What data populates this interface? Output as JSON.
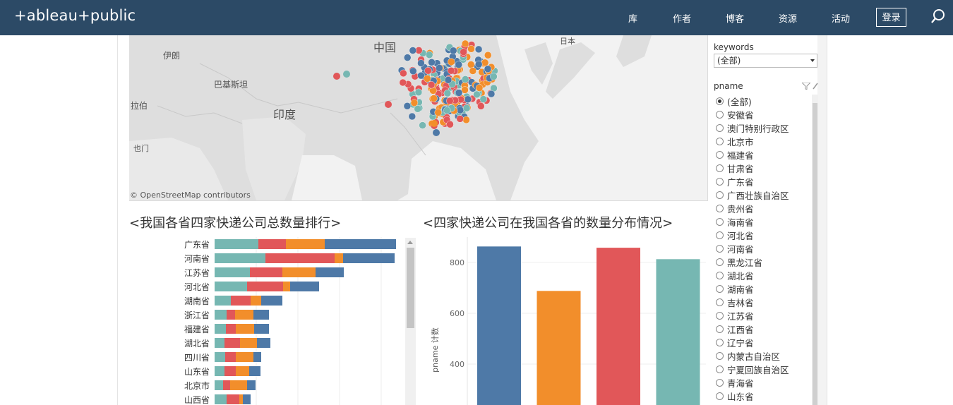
{
  "header": {
    "logo": "+ableau+public",
    "nav": [
      "库",
      "作者",
      "博客",
      "资源",
      "活动"
    ],
    "login": "登录"
  },
  "map": {
    "labels": {
      "china": "中国",
      "japan": "日本",
      "iran": "伊朗",
      "pakistan": "巴基斯坦",
      "india": "印度",
      "karachi": "拉伯",
      "moscow": "也门"
    },
    "credit": "© OpenStreetMap contributors"
  },
  "titles": {
    "left": "<我国各省四家快递公司总数量排行>",
    "right": "<四家快递公司在我国各省的数量分布情况>"
  },
  "colors": {
    "teal": "#76b7b2",
    "red": "#e15759",
    "orange": "#f28e2b",
    "blue": "#4e79a7"
  },
  "chart_data": [
    {
      "type": "bar",
      "orientation": "horizontal",
      "stacked": true,
      "categories": [
        "广东省",
        "河南省",
        "江苏省",
        "河北省",
        "湖南省",
        "浙江省",
        "福建省",
        "湖北省",
        "四川省",
        "山东省",
        "北京市",
        "山西省"
      ],
      "series": [
        {
          "color": "#76b7b2",
          "values": [
            62,
            72,
            50,
            46,
            23,
            17,
            16,
            14,
            15,
            14,
            12,
            17
          ]
        },
        {
          "color": "#e15759",
          "values": [
            39,
            98,
            46,
            51,
            28,
            12,
            14,
            22,
            15,
            16,
            10,
            18
          ]
        },
        {
          "color": "#f28e2b",
          "values": [
            55,
            12,
            47,
            10,
            15,
            26,
            26,
            24,
            25,
            19,
            24,
            5
          ]
        },
        {
          "color": "#4e79a7",
          "values": [
            101,
            73,
            40,
            41,
            30,
            22,
            21,
            19,
            11,
            16,
            12,
            11
          ]
        }
      ]
    },
    {
      "type": "bar",
      "ylabel": "pname 计数",
      "yticks": [
        400,
        600,
        800
      ],
      "ylim": [
        0,
        910
      ],
      "values": [
        863,
        688,
        858,
        813
      ],
      "colors": [
        "#4e79a7",
        "#f28e2b",
        "#e15759",
        "#76b7b2"
      ]
    }
  ],
  "filters": {
    "keywords": {
      "label": "keywords",
      "value": "(全部)"
    },
    "pname": {
      "label": "pname",
      "options": [
        "(全部)",
        "安徽省",
        "澳门特别行政区",
        "北京市",
        "福建省",
        "甘肃省",
        "广东省",
        "广西壮族自治区",
        "贵州省",
        "海南省",
        "河北省",
        "河南省",
        "黑龙江省",
        "湖北省",
        "湖南省",
        "吉林省",
        "江苏省",
        "江西省",
        "辽宁省",
        "内蒙古自治区",
        "宁夏回族自治区",
        "青海省",
        "山东省"
      ],
      "selected": 0
    }
  }
}
